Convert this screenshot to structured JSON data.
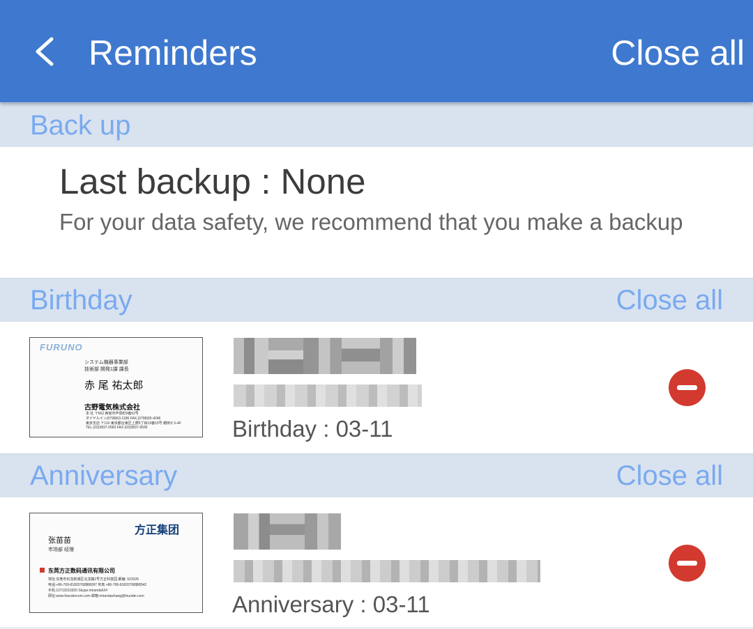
{
  "appbar": {
    "title": "Reminders",
    "action": "Close all",
    "color": "#3f79cf",
    "back_icon": "chevron-left-icon"
  },
  "sections": {
    "backup": {
      "title": "Back up",
      "last_backup": "Last backup : None",
      "subtitle": "For your data safety, we recommend that you make a backup"
    },
    "birthday": {
      "title": "Birthday",
      "action": "Close all",
      "item": {
        "date": "Birthday : 03-11",
        "card": {
          "logo": "FURUNO",
          "lines": [
            "システム機器事業部",
            "技術部 開発1課 課長"
          ],
          "name": "赤 尾 祐太郎",
          "company": "古野電気株式会社",
          "address": [
            "本 社 〒662 西宮市芦原町9番52号",
            "ダイヤルイン(0798)63-1186 FAX.(0798)65-4246",
            "東京支店 〒110 東京都台東区上野5丁目19番15号 朝田ビル4F",
            "TEL.(03)3837-0583 FAX.(03)3837-9930"
          ]
        },
        "remove_icon": "remove-icon"
      }
    },
    "anniversary": {
      "title": "Anniversary",
      "action": "Close all",
      "item": {
        "date": "Anniversary : 03-11",
        "card": {
          "logo": "方正集团",
          "name": "张苗苗",
          "dept": "市场部 经理",
          "company": "东莞方正数码通讯有限公司",
          "details": [
            "地址:东莞市石龙新城区北龙路2号方正科技园 邮编: 523326",
            "电话:+86-769-81820768转8097 传真:+86-769-81820768转8542",
            "手机:13713310320 Skype:miranda624",
            "网址:www.foundercom.com 邮箱:mirandazhang@founder.com"
          ]
        },
        "remove_icon": "remove-icon"
      }
    }
  },
  "colors": {
    "section_header_bg": "#d9e3ef",
    "section_text": "#7aaaf0",
    "remove_button": "#d23a2f"
  }
}
